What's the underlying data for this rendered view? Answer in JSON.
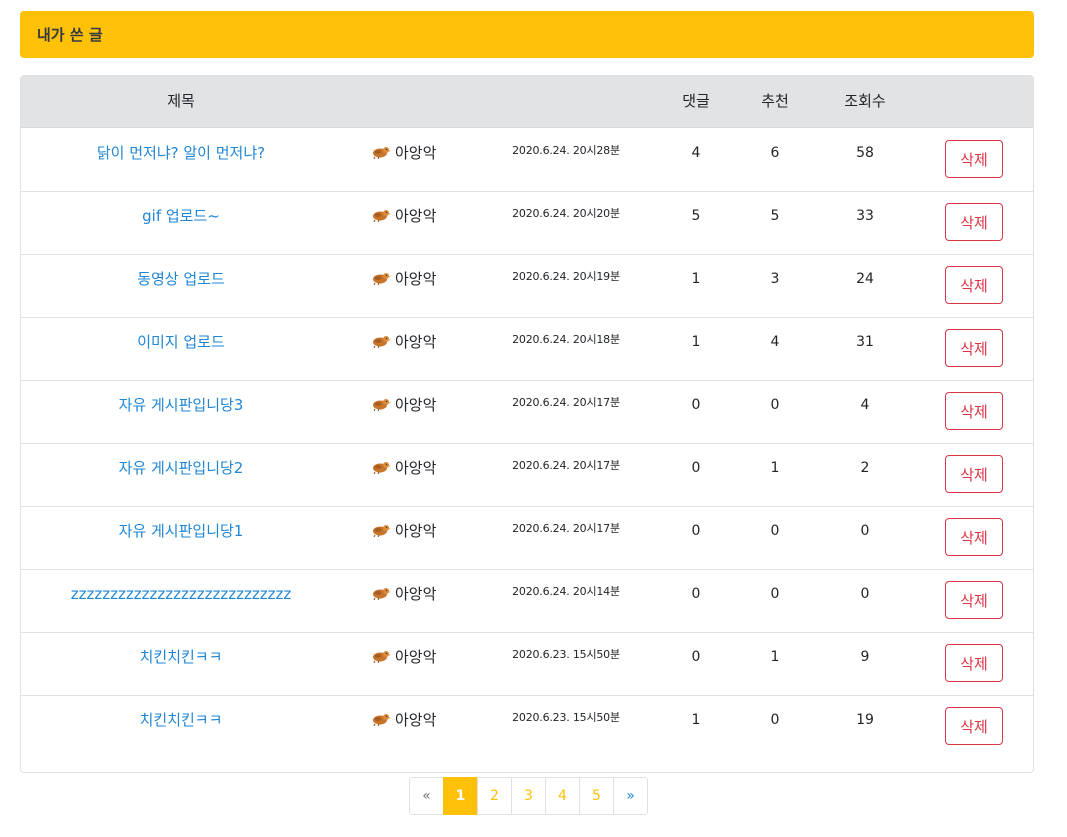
{
  "header": {
    "title": "내가 쓴 글"
  },
  "table": {
    "columns": {
      "title": "제목",
      "comments": "댓글",
      "likes": "추천",
      "views": "조회수"
    },
    "delete_label": "삭제",
    "rows": [
      {
        "title": "닭이 먼저냐? 알이 먼저냐?",
        "author": "아앙악",
        "date": "2020.6.24. 20시28분",
        "comments": "4",
        "likes": "6",
        "views": "58"
      },
      {
        "title": "gif 업로드~",
        "author": "아앙악",
        "date": "2020.6.24. 20시20분",
        "comments": "5",
        "likes": "5",
        "views": "33"
      },
      {
        "title": "동영상 업로드",
        "author": "아앙악",
        "date": "2020.6.24. 20시19분",
        "comments": "1",
        "likes": "3",
        "views": "24"
      },
      {
        "title": "이미지 업로드",
        "author": "아앙악",
        "date": "2020.6.24. 20시18분",
        "comments": "1",
        "likes": "4",
        "views": "31"
      },
      {
        "title": "자유 게시판입니당3",
        "author": "아앙악",
        "date": "2020.6.24. 20시17분",
        "comments": "0",
        "likes": "0",
        "views": "4"
      },
      {
        "title": "자유 게시판입니당2",
        "author": "아앙악",
        "date": "2020.6.24. 20시17분",
        "comments": "0",
        "likes": "1",
        "views": "2"
      },
      {
        "title": "자유 게시판입니당1",
        "author": "아앙악",
        "date": "2020.6.24. 20시17분",
        "comments": "0",
        "likes": "0",
        "views": "0"
      },
      {
        "title": "zzzzzzzzzzzzzzzzzzzzzzzzzzzz",
        "author": "아앙악",
        "date": "2020.6.24. 20시14분",
        "comments": "0",
        "likes": "0",
        "views": "0"
      },
      {
        "title": "치킨치킨ㅋㅋ",
        "author": "아앙악",
        "date": "2020.6.23. 15시50분",
        "comments": "0",
        "likes": "1",
        "views": "9"
      },
      {
        "title": "치킨치킨ㅋㅋ",
        "author": "아앙악",
        "date": "2020.6.23. 15시50분",
        "comments": "1",
        "likes": "0",
        "views": "19"
      }
    ]
  },
  "pagination": {
    "prev": "«",
    "next": "»",
    "pages": [
      "1",
      "2",
      "3",
      "4",
      "5"
    ],
    "current": "1"
  },
  "icons": {
    "author_icon": "chicken-icon"
  },
  "colors": {
    "accent": "#ffc107",
    "link": "#1f86d6",
    "danger": "#dc3545",
    "header_bg": "#e2e3e5"
  }
}
